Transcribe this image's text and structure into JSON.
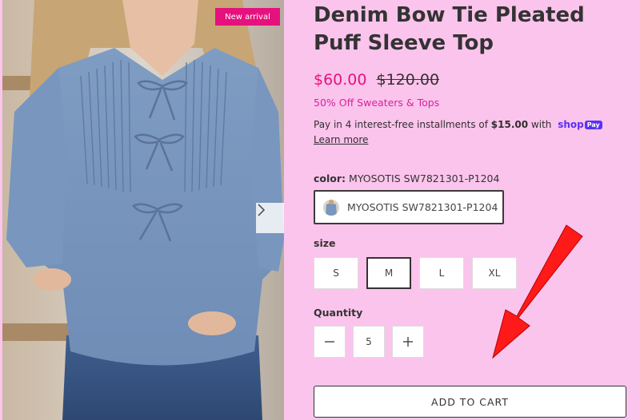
{
  "gallery": {
    "badge": "New arrival",
    "next_icon": "chevron-right-icon"
  },
  "product": {
    "title": "Denim Bow Tie Pleated Puff Sleeve Top",
    "price": "$60.00",
    "compare_price": "$120.00",
    "promo": "50% Off Sweaters & Tops"
  },
  "installments": {
    "prefix": "Pay in 4 interest-free installments of",
    "amount": "$15.00",
    "suffix": "with",
    "brand_shop": "shop",
    "brand_pay": "Pay",
    "learn_more": "Learn more"
  },
  "color": {
    "label": "color:",
    "selected": "MYOSOTIS SW7821301-P1204",
    "option": "MYOSOTIS SW7821301-P1204"
  },
  "size": {
    "label": "size",
    "options": [
      "S",
      "M",
      "L",
      "XL"
    ],
    "selected": "M"
  },
  "quantity": {
    "label": "Quantity",
    "value": "5",
    "decrease_icon": "minus-icon",
    "increase_icon": "plus-icon"
  },
  "cart": {
    "add_label": "ADD TO CART"
  },
  "annotation": {
    "arrow_color": "#ff1a1a"
  },
  "colors": {
    "background": "#fbc4ec",
    "accent": "#e5127e",
    "shop_pay": "#5a31f4"
  }
}
